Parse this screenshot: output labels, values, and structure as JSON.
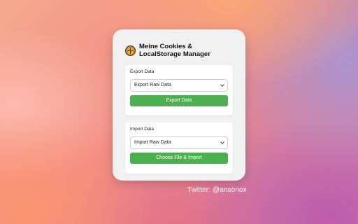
{
  "app": {
    "title": "Meine Cookies & LocalStorage Manager",
    "logo_icon": "cookie-globe-icon"
  },
  "export_section": {
    "label": "Export Data",
    "select_value": "Export Raw Data",
    "button_label": "Export Data"
  },
  "import_section": {
    "label": "Import Data",
    "select_value": "Import Raw Data",
    "button_label": "Choose File & Import"
  },
  "footer": {
    "twitter_text": "Twitter: @ansonox"
  },
  "colors": {
    "button_green": "#4caf50",
    "panel_bg": "#f1f1f1",
    "card_bg": "#ffffff"
  }
}
